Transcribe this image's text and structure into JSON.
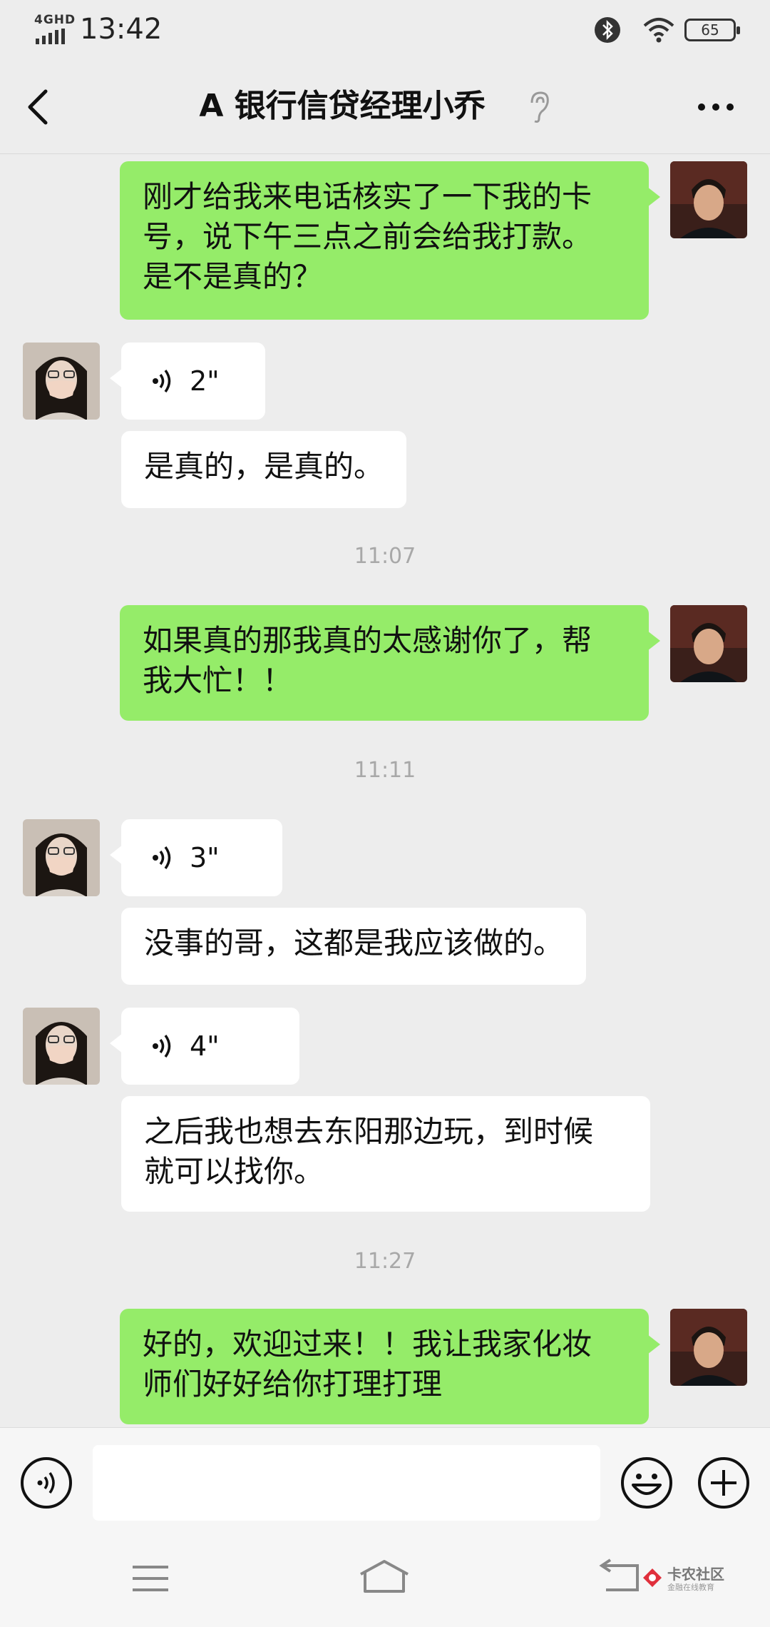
{
  "status_bar": {
    "network": "4GHD",
    "time": "13:42",
    "battery": "65"
  },
  "header": {
    "title": "A 银行信贷经理小乔"
  },
  "messages": [
    {
      "type": "text",
      "sender": "me",
      "text_lines": [
        "刚才给我来电话核实了一下我的卡",
        "号，说下午三点之前会给我打款。",
        "是不是真的？"
      ]
    },
    {
      "type": "voice",
      "sender": "her",
      "duration": "2\""
    },
    {
      "type": "text",
      "sender": "her",
      "text_lines": [
        "是真的，是真的。"
      ]
    },
    {
      "type": "time",
      "text": "11:07"
    },
    {
      "type": "text",
      "sender": "me",
      "text_lines": [
        "如果真的那我真的太感谢你了，帮",
        "我大忙！！"
      ]
    },
    {
      "type": "time",
      "text": "11:11"
    },
    {
      "type": "voice",
      "sender": "her",
      "duration": "3\""
    },
    {
      "type": "text",
      "sender": "her",
      "text_lines": [
        "没事的哥，这都是我应该做的。"
      ]
    },
    {
      "type": "voice",
      "sender": "her",
      "duration": "4\""
    },
    {
      "type": "text",
      "sender": "her",
      "text_lines": [
        "之后我也想去东阳那边玩，到时候",
        "就可以找你。"
      ]
    },
    {
      "type": "time",
      "text": "11:27"
    },
    {
      "type": "text",
      "sender": "me",
      "text_lines": [
        "好的，欢迎过来！！我让我家化妆",
        "师们好好给你打理打理"
      ]
    }
  ],
  "input": {
    "placeholder": ""
  },
  "watermark": {
    "main": "卡农社区",
    "sub": "金融在线教育"
  },
  "colors": {
    "background": "#ededed",
    "my_bubble": "#95ec69",
    "their_bubble": "#ffffff",
    "timestamp": "#a8a8a8"
  },
  "icons": [
    "back-icon",
    "ear-icon",
    "more-icon",
    "voice-wave-icon",
    "voice-mode-icon",
    "emoji-icon",
    "plus-icon",
    "menu-icon",
    "home-icon",
    "nav-back-icon"
  ]
}
